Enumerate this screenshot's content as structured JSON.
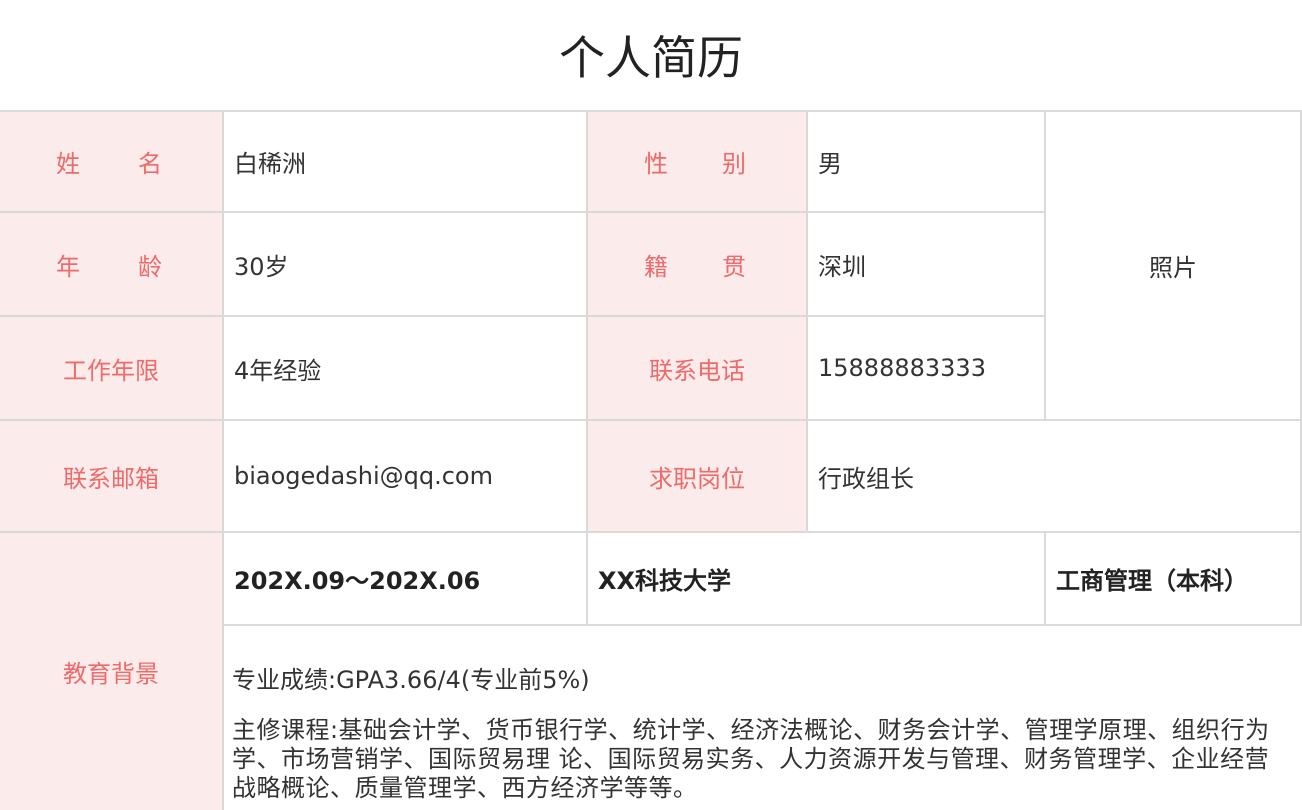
{
  "title": "个人简历",
  "labels": {
    "name": [
      "姓",
      "名"
    ],
    "gender": [
      "性",
      "别"
    ],
    "age": [
      "年",
      "龄"
    ],
    "origin": [
      "籍",
      "贯"
    ],
    "work_years": "工作年限",
    "phone": "联系电话",
    "email": "联系邮箱",
    "position": "求职岗位",
    "education": "教育背景"
  },
  "values": {
    "name": "白稀洲",
    "gender": "男",
    "age": "30岁",
    "origin": "深圳",
    "work_years": "4年经验",
    "phone": "15888883333",
    "email": "biaogedashi@qq.com",
    "position": "行政组长",
    "photo": "照片"
  },
  "education": {
    "period": "202X.09～202X.06",
    "school": "XX科技大学",
    "major": "工商管理（本科）",
    "score": "专业成绩:GPA3.66/4(专业前5%)",
    "courses": "主修课程:基础会计学、货币银行学、统计学、经济法概论、财务会计学、管理学原理、组织行为学、市场营销学、国际贸易理 论、国际贸易实务、人力资源开发与管理、财务管理学、企业经营战略概论、质量管理学、西方经济学等等。"
  }
}
